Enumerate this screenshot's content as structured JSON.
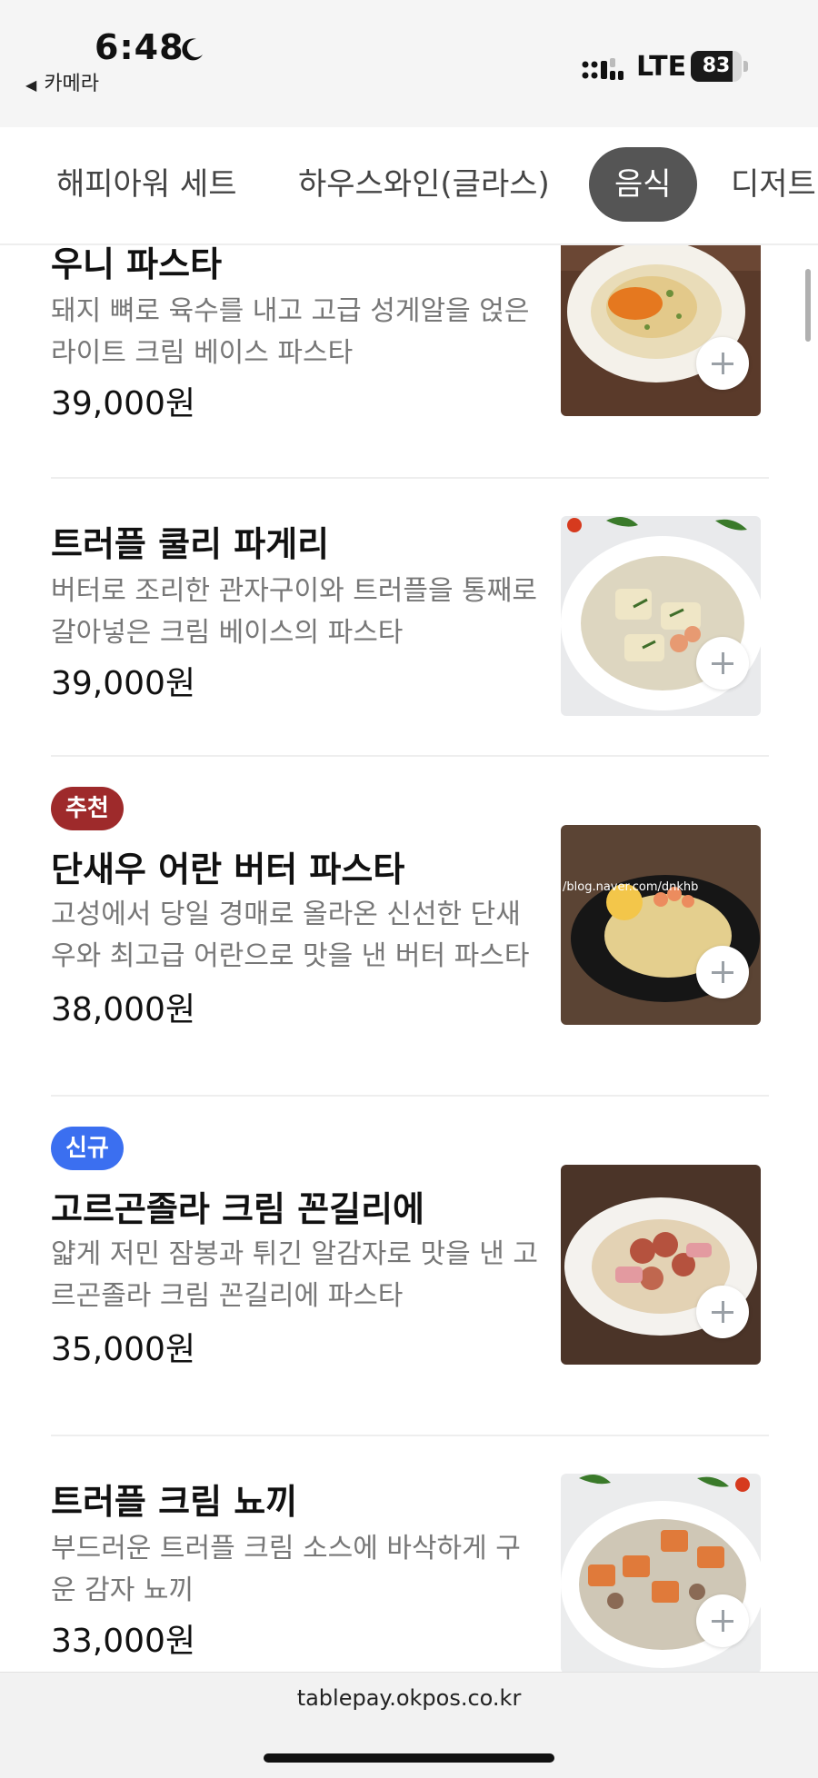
{
  "status_bar": {
    "time": "6:48",
    "back_app": "카메라",
    "network": "LTE",
    "battery_percent": "83"
  },
  "tabs": [
    {
      "label": "해피아워 세트",
      "active": false
    },
    {
      "label": "하우스와인(글라스)",
      "active": false
    },
    {
      "label": "음식",
      "active": true
    },
    {
      "label": "디저트",
      "active": false
    }
  ],
  "menu_items": [
    {
      "badge": "",
      "name": "우니 파스타",
      "desc": "돼지 뼈로 육수를 내고 고급 성게알을 얹은 라이트 크림 베이스 파스타",
      "price": "39,000원",
      "image": "uni-pasta-image"
    },
    {
      "badge": "",
      "name": "트러플 쿨리 파게리",
      "desc": "버터로 조리한 관자구이와 트러플을 통째로 갈아넣은 크림 베이스의 파스타",
      "price": "39,000원",
      "image": "truffle-paccheri-image"
    },
    {
      "badge": "추천",
      "name": "단새우 어란 버터 파스타",
      "desc": "고성에서 당일 경매로 올라온 신선한 단새우와 최고급 어란으로 맛을 낸 버터 파스타",
      "price": "38,000원",
      "image": "shrimp-butter-pasta-image",
      "watermark": "/blog.naver.com/dnkhb"
    },
    {
      "badge": "신규",
      "name": "고르곤졸라 크림 꼰길리에",
      "desc": "얇게 저민 잠봉과 튀긴 알감자로 맛을 낸 고르곤졸라 크림 꼰길리에  파스타",
      "price": "35,000원",
      "image": "gorgonzola-conchiglie-image"
    },
    {
      "badge": "",
      "name": "트러플 크림 뇨끼",
      "desc": "부드러운 트러플 크림 소스에 바삭하게 구운 감자 뇨끼",
      "price": "33,000원",
      "image": "truffle-gnocchi-image"
    }
  ],
  "bottom": {
    "url": "tablepay.okpos.co.kr"
  },
  "colors": {
    "badge_recommend": "#9e2a2b",
    "badge_new": "#3b6ff0",
    "active_tab": "#555555"
  }
}
